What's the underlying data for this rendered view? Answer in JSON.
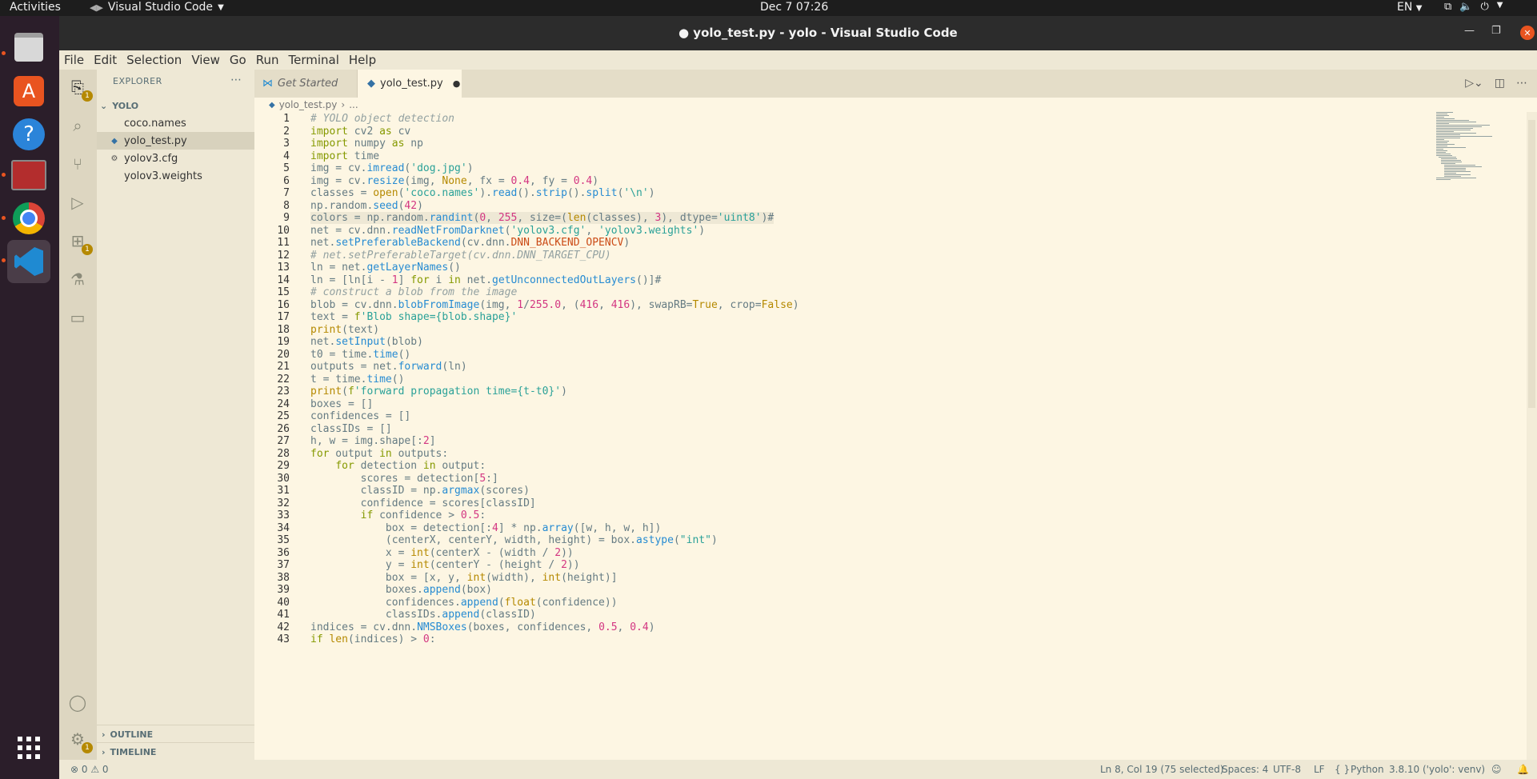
{
  "topbar": {
    "activities": "Activities",
    "app_name": "Visual Studio Code",
    "clock": "Dec 7  07:26",
    "lang": "EN"
  },
  "window": {
    "title": "● yolo_test.py - yolo - Visual Studio Code"
  },
  "menu": [
    "File",
    "Edit",
    "Selection",
    "View",
    "Go",
    "Run",
    "Terminal",
    "Help"
  ],
  "explorer": {
    "header": "EXPLORER",
    "folder": "YOLO",
    "files": [
      {
        "name": "coco.names",
        "icon": "text-file-icon"
      },
      {
        "name": "yolo_test.py",
        "icon": "python-icon"
      },
      {
        "name": "yolov3.cfg",
        "icon": "gear-file-icon"
      },
      {
        "name": "yolov3.weights",
        "icon": "text-file-icon"
      }
    ],
    "outline": "OUTLINE",
    "timeline": "TIMELINE"
  },
  "tabs": [
    {
      "label": "Get Started"
    },
    {
      "label": "yolo_test.py"
    }
  ],
  "breadcrumb": {
    "file": "yolo_test.py",
    "rest": "..."
  },
  "badges": {
    "explorer": "1",
    "extensions": "1",
    "settings": "1"
  },
  "code_lines": [
    "# YOLO object detection",
    "import cv2 as cv",
    "import numpy as np",
    "import time",
    "img = cv.imread('dog.jpg')",
    "img = cv.resize(img, None, fx = 0.4, fy = 0.4)",
    "classes = open('coco.names').read().strip().split('\\n')",
    "np.random.seed(42)",
    "colors = np.random.randint(0, 255, size=(len(classes), 3), dtype='uint8')#",
    "net = cv.dnn.readNetFromDarknet('yolov3.cfg', 'yolov3.weights')",
    "net.setPreferableBackend(cv.dnn.DNN_BACKEND_OPENCV)",
    "# net.setPreferableTarget(cv.dnn.DNN_TARGET_CPU)",
    "ln = net.getLayerNames()",
    "ln = [ln[i - 1] for i in net.getUnconnectedOutLayers()]#",
    "# construct a blob from the image",
    "blob = cv.dnn.blobFromImage(img, 1/255.0, (416, 416), swapRB=True, crop=False)",
    "text = f'Blob shape={blob.shape}'",
    "print(text)",
    "net.setInput(blob)",
    "t0 = time.time()",
    "outputs = net.forward(ln)",
    "t = time.time()",
    "print(f'forward propagation time={t-t0}')",
    "boxes = []",
    "confidences = []",
    "classIDs = []",
    "h, w = img.shape[:2]",
    "for output in outputs:",
    "    for detection in output:",
    "        scores = detection[5:]",
    "        classID = np.argmax(scores)",
    "        confidence = scores[classID]",
    "        if confidence > 0.5:",
    "            box = detection[:4] * np.array([w, h, w, h])",
    "            (centerX, centerY, width, height) = box.astype(\"int\")",
    "            x = int(centerX - (width / 2))",
    "            y = int(centerY - (height / 2))",
    "            box = [x, y, int(width), int(height)]",
    "            boxes.append(box)",
    "            confidences.append(float(confidence))",
    "            classIDs.append(classID)",
    "indices = cv.dnn.NMSBoxes(boxes, confidences, 0.5, 0.4)",
    "if len(indices) > 0:"
  ],
  "status": {
    "problems": "⊗ 0  ⚠ 0",
    "position": "Ln 8, Col 19 (75 selected)",
    "spaces": "Spaces: 4",
    "encoding": "UTF-8",
    "eol": "LF",
    "language": "Python",
    "interpreter": "3.8.10 ('yolo': venv)"
  },
  "colors": {
    "keyword": "#859900",
    "string": "#2aa198",
    "number": "#d33682",
    "comment": "#93a1a1",
    "function": "#268bd2",
    "accent": "#e95420"
  }
}
